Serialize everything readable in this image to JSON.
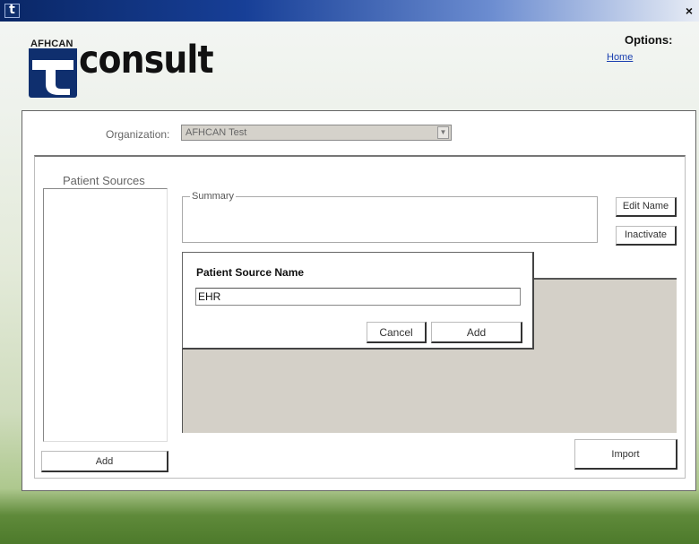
{
  "window": {
    "app_icon_glyph": "t",
    "close_glyph": "×"
  },
  "header": {
    "logo_small_text": "AFHCAN",
    "logo_word": "consult",
    "options_label": "Options:",
    "home_link": "Home"
  },
  "organization": {
    "label": "Organization:",
    "selected": "AFHCAN Test",
    "arrow_glyph": "▼"
  },
  "patient_sources": {
    "label": "Patient Sources",
    "items": [],
    "add_button": "Add"
  },
  "summary": {
    "label": "Summary",
    "edit_name_button": "Edit Name",
    "inactivate_button": "Inactivate"
  },
  "import_button": "Import",
  "dialog": {
    "title": "Patient Source Name",
    "input_value": "EHR",
    "cancel_button": "Cancel",
    "add_button": "Add"
  },
  "colors": {
    "title_bar": "#173f97",
    "brand_dark": "#0f2f6e",
    "link": "#1a3fb0",
    "panel_gray": "#d4d0c8"
  }
}
